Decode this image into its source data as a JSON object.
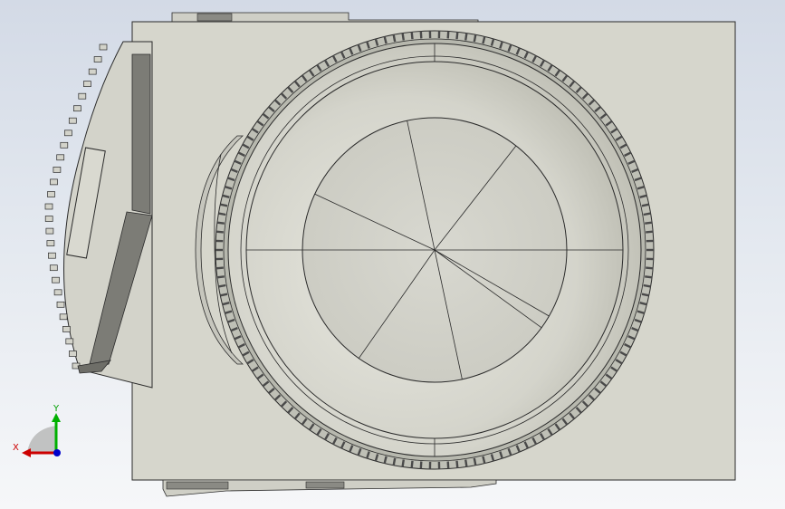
{
  "viewport": {
    "background_top": "#d3dae6",
    "background_bottom": "#f6f7f9"
  },
  "model": {
    "body_color": "#d6d6cc",
    "edge_color": "#2a2a2a",
    "ring_color": "#c9cabf",
    "dial_color": "#d0d0c8",
    "tooth_color": "#4a4a4a",
    "shade_color": "#7c7c76"
  },
  "triad": {
    "x_label": "X",
    "y_label": "Y",
    "x_color": "#cc0000",
    "y_color": "#00b000",
    "z_color": "#0000cc"
  }
}
